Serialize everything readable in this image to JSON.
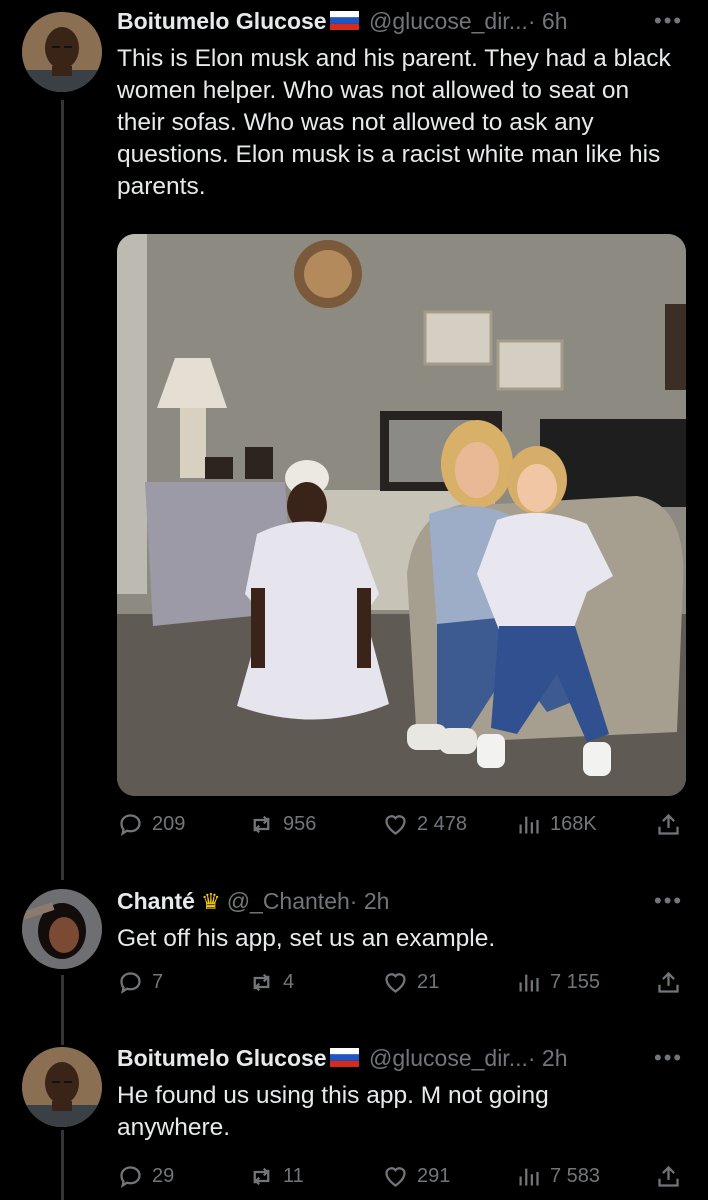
{
  "tweets": [
    {
      "name": "Boitumelo Glucose",
      "handle": "@glucose_dir...",
      "time": "· 6h",
      "text": "This is Elon musk and his parent. They had a black women helper. Who was not allowed to seat on their sofas. Who was not allowed to ask any questions. Elon musk is a racist white man like his parents.",
      "stats": {
        "replies": "209",
        "reposts": "956",
        "likes": "2 478",
        "views": "168K"
      }
    },
    {
      "name": "Chanté",
      "handle": "@_Chanteh",
      "time": "· 2h",
      "text": "Get off his app, set us an example.",
      "stats": {
        "replies": "7",
        "reposts": "4",
        "likes": "21",
        "views": "7 155"
      }
    },
    {
      "name": "Boitumelo Glucose",
      "handle": "@glucose_dir...",
      "time": "· 2h",
      "text": "He found us using this app. M not going anywhere.",
      "stats": {
        "replies": "29",
        "reposts": "11",
        "likes": "291",
        "views": "7 583"
      }
    }
  ],
  "icons": {
    "more": "more-horizontal-icon",
    "reply": "reply-bubble-icon",
    "repost": "repost-arrows-icon",
    "like": "heart-icon",
    "views": "views-bar-chart-icon",
    "share": "share-upload-icon",
    "flag": "russia-flag-icon",
    "crown": "crown-emoji-icon"
  },
  "colors": {
    "background": "#000000",
    "text": "#e7e9ea",
    "muted": "#71767b"
  }
}
